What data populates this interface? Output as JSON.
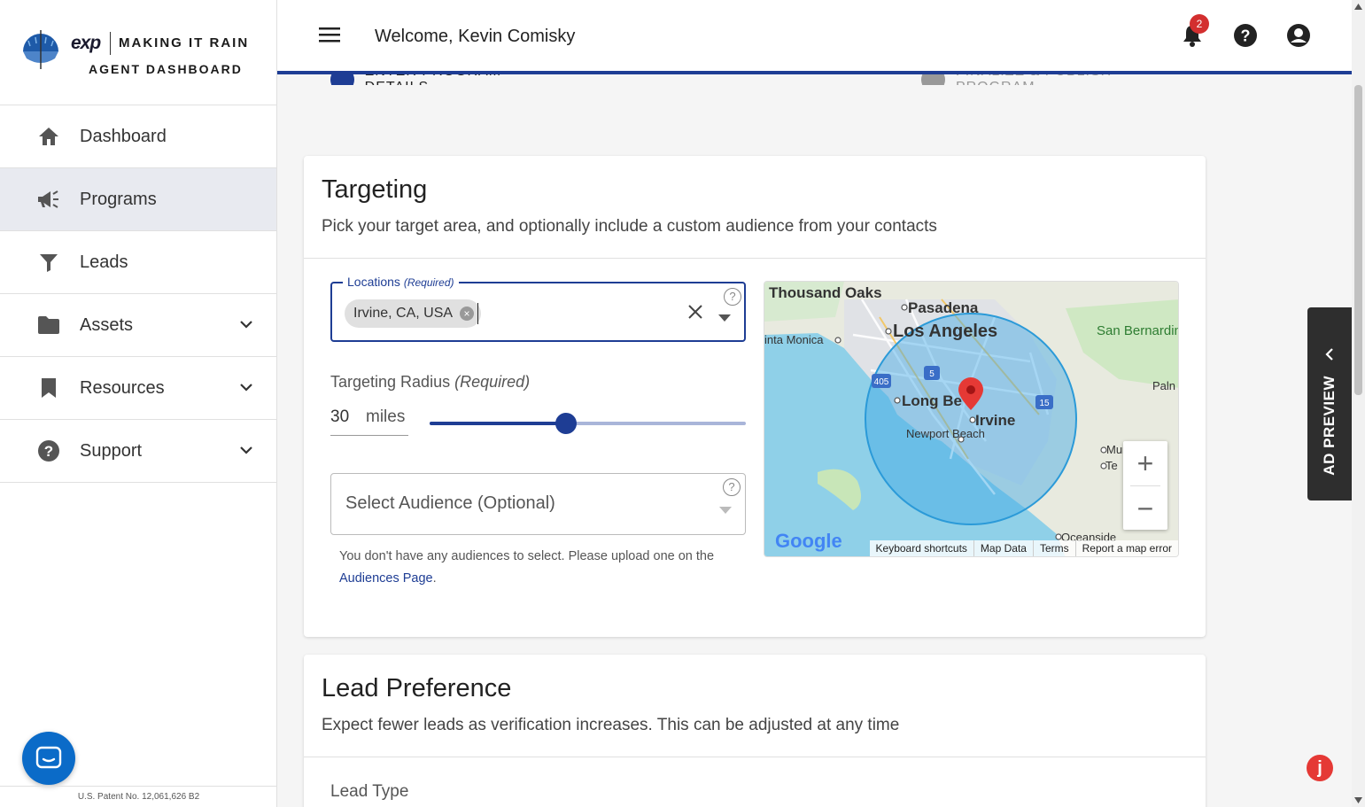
{
  "brand": {
    "logo_text": "exp",
    "title": "MAKING IT RAIN",
    "subtitle": "AGENT DASHBOARD"
  },
  "sidebar": {
    "items": [
      {
        "label": "Dashboard",
        "icon": "home-icon"
      },
      {
        "label": "Programs",
        "icon": "megaphone-icon",
        "active": true
      },
      {
        "label": "Leads",
        "icon": "funnel-icon"
      },
      {
        "label": "Assets",
        "icon": "folder-icon",
        "expandable": true
      },
      {
        "label": "Resources",
        "icon": "bookmark-icon",
        "expandable": true
      },
      {
        "label": "Support",
        "icon": "help-circle-icon",
        "expandable": true
      }
    ],
    "patent": "U.S. Patent No. 12,061,626 B2"
  },
  "header": {
    "welcome": "Welcome, Kevin Comisky",
    "notification_count": "2"
  },
  "stepper": {
    "step1": "ENTER PROGRAM DETAILS",
    "step2": "FINALIZE & PUBLISH PROGRAM"
  },
  "targeting": {
    "title": "Targeting",
    "subtitle": "Pick your target area, and optionally include a custom audience from your contacts",
    "locations_label": "Locations",
    "locations_required": "(Required)",
    "location_chip": "Irvine, CA, USA",
    "radius_label": "Targeting Radius",
    "radius_required": "(Required)",
    "radius_value": "30",
    "radius_unit": "miles",
    "radius_slider_fraction": 0.43,
    "audience_placeholder": "Select Audience (Optional)",
    "audience_help": "You don't have any audiences to select. Please upload one on the",
    "audience_link": "Audiences Page",
    "audience_help_end": "."
  },
  "map": {
    "labels": {
      "thousand_oaks": "Thousand Oaks",
      "pasadena": "Pasadena",
      "los_angeles": "Los Angeles",
      "santa_monica": "inta Monica",
      "san_bernardino": "San Bernardin National For",
      "long_beach": "Long Be",
      "irvine": "Irvine",
      "newport_beach": "Newport Beach",
      "palm": "Paln",
      "murrieta": "Mur",
      "temecula": "Te",
      "oceanside": "Oceanside",
      "hw405": "405",
      "hw5": "5",
      "hw15": "15"
    },
    "footer": [
      "Keyboard shortcuts",
      "Map Data",
      "Terms",
      "Report a map error"
    ],
    "google": "Google"
  },
  "lead_preference": {
    "title": "Lead Preference",
    "subtitle": "Expect fewer leads as verification increases. This can be adjusted at any time",
    "lead_type_label": "Lead Type"
  },
  "ad_preview": "AD PREVIEW",
  "colors": {
    "primary": "#1e3d94",
    "badge": "#d32f2f",
    "chat": "#0b6bc8"
  }
}
